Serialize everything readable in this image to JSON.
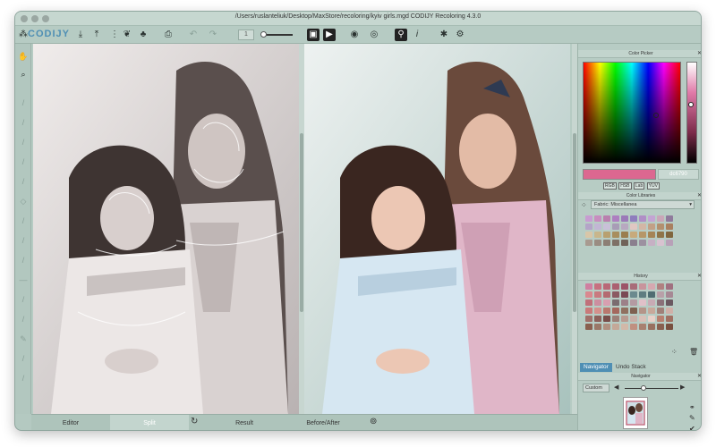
{
  "window": {
    "title": "/Users/ruslanteliuk/Desktop/MaxStore/recoloring/kyiv girls.mgd CODIJY Recoloring 4.3.0"
  },
  "toolbar": {
    "logo": "CODIJY",
    "opacity_value": "1",
    "icons": [
      "import-icon",
      "export-icon",
      "share-icon",
      "palette-icon",
      "stamp-icon",
      "print-icon",
      "undo-icon",
      "redo-icon",
      "render-icon",
      "play-icon",
      "eye-icon",
      "visibility-icon",
      "link-icon",
      "info-icon",
      "star-icon",
      "settings-icon"
    ]
  },
  "left_tools": [
    "hand-icon",
    "zoom-icon",
    "brush-icon",
    "brush-icon",
    "brush-icon",
    "eraser-icon",
    "brush-icon",
    "fill-icon",
    "picker-icon",
    "brush-icon",
    "brush-icon",
    "line-icon",
    "brush-icon",
    "brush-icon",
    "pen-icon",
    "brush-icon",
    "brush-icon"
  ],
  "view_tabs": [
    {
      "label": "Editor",
      "active": false
    },
    {
      "label": "Split",
      "active": true
    },
    {
      "label": "Result",
      "active": false
    },
    {
      "label": "Before/After",
      "active": false
    }
  ],
  "color_picker": {
    "title": "Color Picker",
    "current_color": "#dc6790",
    "hex_value": "dc6790",
    "modes": [
      "RGB",
      "HSB",
      "Lab",
      "YUV"
    ]
  },
  "color_libraries": {
    "title": "Color Libraries",
    "selected_library": "Fabric: Miscellanea",
    "swatches": [
      "#c79cd1",
      "#c78dbf",
      "#b97fae",
      "#ad7fc0",
      "#9b79b8",
      "#8f7dbd",
      "#b08ec6",
      "#c3a4d3",
      "#c9a6b8",
      "#8f7a9c",
      "#b4a4c8",
      "#c2b6d4",
      "#c9c0d8",
      "#a89cb6",
      "#b8a8c0",
      "#e0c7c2",
      "#d3b6a5",
      "#c2a086",
      "#b3906f",
      "#a98060",
      "#d8c6a8",
      "#c8b68c",
      "#b8a070",
      "#a88e5e",
      "#9a7e4f",
      "#c7aa7c",
      "#b69668",
      "#a58456",
      "#8f7448",
      "#80663e",
      "#a89a90",
      "#9a8c82",
      "#8c7e74",
      "#7e7066",
      "#706258",
      "#8a7f8e",
      "#9c90a0",
      "#c6b0c4",
      "#d8c2d0",
      "#b8a0b8"
    ]
  },
  "history": {
    "title": "History",
    "swatches": [
      "#cf7fa0",
      "#c7707f",
      "#b96877",
      "#ab6070",
      "#9c5467",
      "#a86c78",
      "#c8949c",
      "#d6a8b0",
      "#b08080",
      "#a07080",
      "#d9888f",
      "#c97a80",
      "#b46b70",
      "#8b5a62",
      "#7a4a54",
      "#6b8a8e",
      "#5e7c80",
      "#4f6d72",
      "#b8a0a8",
      "#a68894",
      "#c0707a",
      "#cc8ea0",
      "#d89fb0",
      "#7a6c70",
      "#9c8088",
      "#b49aa2",
      "#e0c0c8",
      "#c8aab4",
      "#8a7078",
      "#6a5860",
      "#c97a7a",
      "#d4908c",
      "#b9786e",
      "#a4685e",
      "#907060",
      "#7e6050",
      "#b49488",
      "#c8a89a",
      "#a08078",
      "#d0b0a8",
      "#a0706a",
      "#8c605a",
      "#784e4a",
      "#9c8078",
      "#b89a90",
      "#c8b0a8",
      "#d8c0b8",
      "#e8d0c8",
      "#b88070",
      "#a07062",
      "#8a6050",
      "#9a7868",
      "#b09080",
      "#c4a898",
      "#d2b8a8",
      "#c09080",
      "#a88070",
      "#987060",
      "#886050",
      "#785040"
    ]
  },
  "navigator": {
    "tabs": [
      {
        "label": "Navigator",
        "active": true
      },
      {
        "label": "Undo Stack",
        "active": false
      }
    ],
    "title": "Navigator",
    "zoom_value": "Custom"
  },
  "colors": {
    "accent": "#4f8fb4",
    "chrome": "#b4c9c1"
  }
}
